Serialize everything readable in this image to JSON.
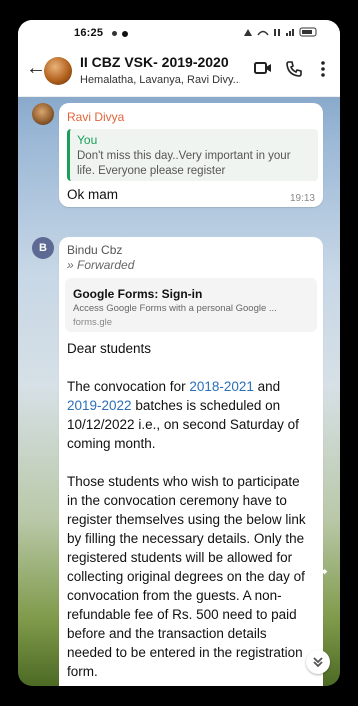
{
  "status": {
    "time": "16:25"
  },
  "header": {
    "title": "II CBZ VSK- 2019-2020",
    "subtitle": "Hemalatha, Lavanya, Ravi Divy..."
  },
  "messages": [
    {
      "sender": "Ravi Divya",
      "quote_name": "You",
      "quote_text": "Don't miss this day..Very important in your life. Everyone please register",
      "text": "Ok mam",
      "time": "19:13"
    },
    {
      "avatar_letter": "B",
      "sender": "Bindu Cbz",
      "forwarded": "Forwarded",
      "link_title": "Google Forms: Sign-in",
      "link_desc": "Access Google Forms with a personal Google ...",
      "link_url": "forms.gle",
      "greeting": "Dear students",
      "p2_a": "The convocation for ",
      "p2_year1": "2018-2021",
      "p2_b": " and ",
      "p2_year2": "2019-2022",
      "p2_c": " batches is scheduled on 10/12/2022 i.e., on second Saturday of coming month.",
      "p3": "Those students who wish to participate in the convocation ceremony have to register themselves using the below link by filling the necessary details. Only the registered students will be allowed for collecting original degrees on the day of convocation from the guests. A non-refundable fee of Rs. 500 need to paid before and the transaction details needed to be entered in the registration form."
    }
  ],
  "colors": {
    "accent_green": "#1a9e5a",
    "sender_orange": "#e1653a",
    "link_blue": "#2b6fb8"
  }
}
